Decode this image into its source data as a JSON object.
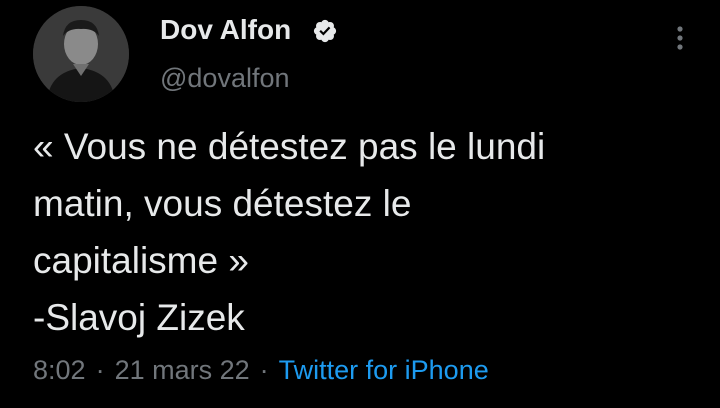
{
  "author": {
    "name": "Dov Alfon",
    "handle": "@dovalfon",
    "verified": true
  },
  "tweet": {
    "lines": [
      "« Vous ne détestez pas le lundi",
      "matin, vous détestez le",
      "capitalisme »",
      "-Slavoj Zizek"
    ]
  },
  "meta": {
    "time": "8:02",
    "separator": "·",
    "date": "21 mars 22",
    "source": "Twitter for iPhone"
  },
  "icons": {
    "verified": "verified-badge-icon",
    "more": "more-vertical-icon"
  },
  "colors": {
    "background": "#000000",
    "text": "#e7e9ea",
    "secondary": "#71767b",
    "link": "#1d9bf0"
  }
}
